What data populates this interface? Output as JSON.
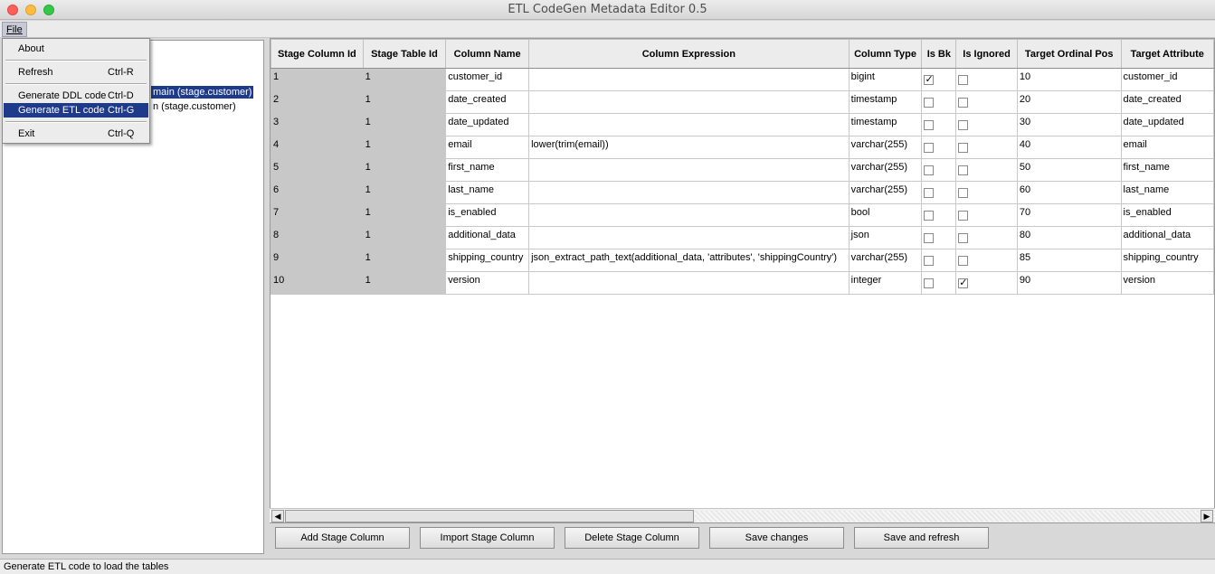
{
  "window": {
    "title": "ETL CodeGen Metadata Editor 0.5"
  },
  "menubar": {
    "file_label": "File"
  },
  "file_menu": {
    "about": "About",
    "refresh": "Refresh",
    "refresh_shortcut": "Ctrl-R",
    "generate_ddl": "Generate DDL code",
    "generate_ddl_shortcut": "Ctrl-D",
    "generate_etl": "Generate ETL code",
    "generate_etl_shortcut": "Ctrl-G",
    "exit": "Exit",
    "exit_shortcut": "Ctrl-Q"
  },
  "tree": {
    "items": [
      {
        "label": "main (stage.customer)",
        "selected": true
      },
      {
        "label": "n (stage.customer)",
        "selected": false
      }
    ]
  },
  "grid": {
    "columns": [
      "Stage Column Id",
      "Stage Table Id",
      "Column Name",
      "Column Expression",
      "Column Type",
      "Is Bk",
      "Is Ignored",
      "Target Ordinal Pos",
      "Target Attribute"
    ],
    "rows": [
      {
        "stage_column_id": "1",
        "stage_table_id": "1",
        "column_name": "customer_id",
        "column_expression": "",
        "column_type": "bigint",
        "is_bk": true,
        "is_ignored": false,
        "target_ordinal_pos": "10",
        "target_attribute": "customer_id"
      },
      {
        "stage_column_id": "2",
        "stage_table_id": "1",
        "column_name": "date_created",
        "column_expression": "",
        "column_type": "timestamp",
        "is_bk": false,
        "is_ignored": false,
        "target_ordinal_pos": "20",
        "target_attribute": "date_created"
      },
      {
        "stage_column_id": "3",
        "stage_table_id": "1",
        "column_name": "date_updated",
        "column_expression": "",
        "column_type": "timestamp",
        "is_bk": false,
        "is_ignored": false,
        "target_ordinal_pos": "30",
        "target_attribute": "date_updated"
      },
      {
        "stage_column_id": "4",
        "stage_table_id": "1",
        "column_name": "email",
        "column_expression": "lower(trim(email))",
        "column_type": "varchar(255)",
        "is_bk": false,
        "is_ignored": false,
        "target_ordinal_pos": "40",
        "target_attribute": "email"
      },
      {
        "stage_column_id": "5",
        "stage_table_id": "1",
        "column_name": "first_name",
        "column_expression": "",
        "column_type": "varchar(255)",
        "is_bk": false,
        "is_ignored": false,
        "target_ordinal_pos": "50",
        "target_attribute": "first_name"
      },
      {
        "stage_column_id": "6",
        "stage_table_id": "1",
        "column_name": "last_name",
        "column_expression": "",
        "column_type": "varchar(255)",
        "is_bk": false,
        "is_ignored": false,
        "target_ordinal_pos": "60",
        "target_attribute": "last_name"
      },
      {
        "stage_column_id": "7",
        "stage_table_id": "1",
        "column_name": "is_enabled",
        "column_expression": "",
        "column_type": "bool",
        "is_bk": false,
        "is_ignored": false,
        "target_ordinal_pos": "70",
        "target_attribute": "is_enabled"
      },
      {
        "stage_column_id": "8",
        "stage_table_id": "1",
        "column_name": "additional_data",
        "column_expression": "",
        "column_type": "json",
        "is_bk": false,
        "is_ignored": false,
        "target_ordinal_pos": "80",
        "target_attribute": "additional_data"
      },
      {
        "stage_column_id": "9",
        "stage_table_id": "1",
        "column_name": "shipping_country",
        "column_expression": "json_extract_path_text(additional_data, 'attributes', 'shippingCountry')",
        "column_type": "varchar(255)",
        "is_bk": false,
        "is_ignored": false,
        "target_ordinal_pos": "85",
        "target_attribute": "shipping_country"
      },
      {
        "stage_column_id": "10",
        "stage_table_id": "1",
        "column_name": "version",
        "column_expression": "",
        "column_type": "integer",
        "is_bk": false,
        "is_ignored": true,
        "target_ordinal_pos": "90",
        "target_attribute": "version"
      }
    ]
  },
  "buttons": {
    "add": "Add Stage Column",
    "import": "Import Stage Column",
    "delete": "Delete Stage Column",
    "save": "Save changes",
    "save_refresh": "Save and refresh"
  },
  "status": {
    "text": "Generate ETL code to load the tables"
  },
  "colors": {
    "selection": "#1e3a8a",
    "readonly_cell": "#c8c8c8"
  }
}
